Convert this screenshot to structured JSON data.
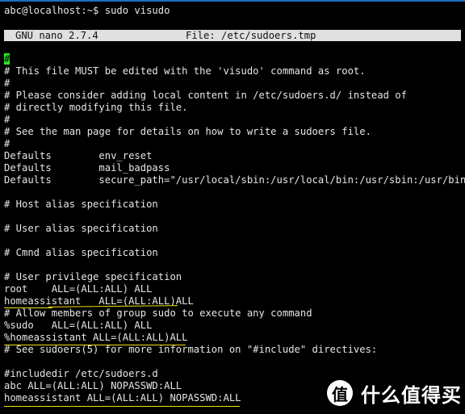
{
  "terminal": {
    "prompt_line": "abc@localhost:~$ sudo visudo",
    "colors": {
      "background": "#000000",
      "text": "#e6e6e6",
      "titlebar_bg": "#e0e0e0",
      "cursor": "#22ee22",
      "annotation": "#f0e010",
      "top_border": "#1a6fc4"
    }
  },
  "nano": {
    "version_label": "GNU nano 2.7.4",
    "file_label": "File: /etc/sudoers.tmp",
    "cursor_char": "#",
    "lines": [
      "# This file MUST be edited with the 'visudo' command as root.",
      "#",
      "# Please consider adding local content in /etc/sudoers.d/ instead of",
      "# directly modifying this file.",
      "#",
      "# See the man page for details on how to write a sudoers file.",
      "#",
      "Defaults        env_reset",
      "Defaults        mail_badpass",
      "Defaults        secure_path=\"/usr/local/sbin:/usr/local/bin:/usr/sbin:/usr/bin:$",
      "",
      "# Host alias specification",
      "",
      "# User alias specification",
      "",
      "# Cmnd alias specification",
      "",
      "# User privilege specification",
      "root    ALL=(ALL:ALL) ALL",
      "homeassistant   ALL=(ALL:ALL)ALL",
      "# Allow members of group sudo to execute any command",
      "%sudo   ALL=(ALL:ALL) ALL",
      "%homeassistant ALL=(ALL:ALL)ALL",
      "# See sudoers(5) for more information on \"#include\" directives:",
      "",
      "#includedir /etc/sudoers.d",
      "abc ALL=(ALL:ALL) NOPASSWD:ALL",
      "homeassistant ALL=(ALL:ALL) NOPASSWD:ALL"
    ]
  },
  "watermark": {
    "badge_char": "值",
    "text": "什么值得买"
  }
}
